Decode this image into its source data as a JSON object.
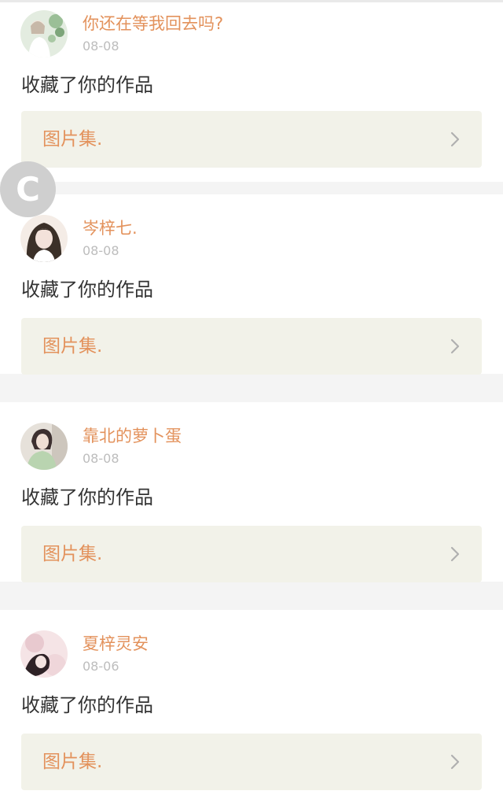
{
  "notifications": [
    {
      "username": "你还在等我回去吗?",
      "date": "08-08",
      "action": "收藏了你的作品",
      "collection": "图片集.",
      "avatar_icon": "avatar-girl-white-flowers",
      "avatar_colors": [
        "#cfe0cf",
        "#eaf0e6",
        "#7da57a"
      ]
    },
    {
      "username": "岑梓七.",
      "date": "08-08",
      "action": "收藏了你的作品",
      "collection": "图片集.",
      "avatar_icon": "avatar-girl-dark-hair",
      "avatar_colors": [
        "#3b3028",
        "#f3e2da",
        "#ffffff"
      ]
    },
    {
      "username": "靠北的萝卜蛋",
      "date": "08-08",
      "action": "收藏了你的作品",
      "collection": "图片集.",
      "avatar_icon": "avatar-girl-green-sweater",
      "avatar_colors": [
        "#d9d4cc",
        "#b9d4b0",
        "#3d3030"
      ]
    },
    {
      "username": "夏梓灵安",
      "date": "08-06",
      "action": "收藏了你的作品",
      "collection": "图片集.",
      "avatar_icon": "avatar-girl-pink-tones",
      "avatar_colors": [
        "#e8c9cf",
        "#f5e4e6",
        "#2e2226"
      ]
    }
  ],
  "floating_button": {
    "label": "C",
    "icon": "copyright-c-icon"
  },
  "theme": {
    "accent": "#e3925c",
    "muted": "#bdbdbd",
    "text": "#333333",
    "box_bg": "#f2f2e9",
    "separator": "#f4f4f4"
  }
}
